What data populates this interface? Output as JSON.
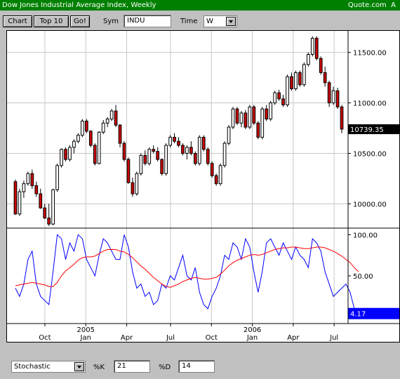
{
  "title": "Dow Jones Industrial Average Index, Weekly",
  "source": "Quote.com",
  "source_suffix": "A",
  "toolbar": {
    "chart_button": "Chart",
    "top10_button": "Top 10",
    "go_button": "Go!",
    "sym_label": "Sym",
    "sym_value": "INDU",
    "time_label": "Time",
    "time_value": "W"
  },
  "bottom": {
    "indicator_value": "Stochastic",
    "k_label": "%K",
    "k_value": "21",
    "d_label": "%D",
    "d_value": "14"
  },
  "colors": {
    "up": "#ffffff",
    "down": "#cc0000",
    "k_line": "#0000ff",
    "d_line": "#ff0000",
    "last_price_bg": "#000000",
    "last_stoch_bg": "#0000ff"
  },
  "chart_data": [
    {
      "type": "candlestick",
      "title": "",
      "ylim": [
        9760,
        11720
      ],
      "y_ticks": [
        {
          "value": 10000,
          "label": "10000.00"
        },
        {
          "value": 10500,
          "label": "10500.00"
        },
        {
          "value": 11000,
          "label": "11000.00"
        },
        {
          "value": 11500,
          "label": "11500.00"
        }
      ],
      "last_value_label": "10739.35",
      "last_value": 10739.35,
      "candles": [
        [
          10220,
          10240,
          9890,
          9900
        ],
        [
          9900,
          10150,
          9880,
          10120
        ],
        [
          10120,
          10230,
          10060,
          10200
        ],
        [
          10200,
          10320,
          10180,
          10300
        ],
        [
          10300,
          10340,
          10150,
          10180
        ],
        [
          10180,
          10220,
          10070,
          10100
        ],
        [
          10100,
          10150,
          9950,
          9960
        ],
        [
          9960,
          10000,
          9850,
          9860
        ],
        [
          9860,
          10000,
          9780,
          9800
        ],
        [
          9800,
          10150,
          9790,
          10140
        ],
        [
          10140,
          10400,
          10120,
          10380
        ],
        [
          10380,
          10550,
          10360,
          10540
        ],
        [
          10540,
          10560,
          10420,
          10440
        ],
        [
          10440,
          10580,
          10420,
          10560
        ],
        [
          10560,
          10640,
          10500,
          10620
        ],
        [
          10620,
          10700,
          10600,
          10680
        ],
        [
          10680,
          10840,
          10660,
          10820
        ],
        [
          10820,
          10840,
          10700,
          10720
        ],
        [
          10720,
          10730,
          10560,
          10580
        ],
        [
          10580,
          10600,
          10380,
          10400
        ],
        [
          10400,
          10720,
          10390,
          10710
        ],
        [
          10710,
          10830,
          10690,
          10800
        ],
        [
          10800,
          10860,
          10760,
          10840
        ],
        [
          10840,
          10940,
          10820,
          10920
        ],
        [
          10920,
          10980,
          10760,
          10780
        ],
        [
          10780,
          10790,
          10560,
          10600
        ],
        [
          10600,
          10620,
          10420,
          10440
        ],
        [
          10440,
          10460,
          10200,
          10210
        ],
        [
          10210,
          10260,
          10070,
          10100
        ],
        [
          10100,
          10320,
          10080,
          10300
        ],
        [
          10300,
          10500,
          10280,
          10480
        ],
        [
          10480,
          10530,
          10380,
          10400
        ],
        [
          10400,
          10560,
          10380,
          10540
        ],
        [
          10540,
          10580,
          10500,
          10520
        ],
        [
          10520,
          10560,
          10420,
          10440
        ],
        [
          10440,
          10450,
          10280,
          10300
        ],
        [
          10300,
          10600,
          10280,
          10580
        ],
        [
          10580,
          10680,
          10560,
          10660
        ],
        [
          10660,
          10700,
          10600,
          10620
        ],
        [
          10620,
          10660,
          10560,
          10580
        ],
        [
          10580,
          10600,
          10480,
          10500
        ],
        [
          10500,
          10580,
          10440,
          10560
        ],
        [
          10560,
          10620,
          10480,
          10500
        ],
        [
          10500,
          10520,
          10380,
          10400
        ],
        [
          10400,
          10680,
          10380,
          10660
        ],
        [
          10660,
          10680,
          10520,
          10540
        ],
        [
          10540,
          10560,
          10380,
          10400
        ],
        [
          10400,
          10420,
          10260,
          10280
        ],
        [
          10280,
          10300,
          10180,
          10200
        ],
        [
          10200,
          10400,
          10180,
          10380
        ],
        [
          10380,
          10620,
          10360,
          10600
        ],
        [
          10600,
          10780,
          10580,
          10760
        ],
        [
          10760,
          10960,
          10740,
          10940
        ],
        [
          10940,
          10960,
          10780,
          10800
        ],
        [
          10800,
          10920,
          10760,
          10900
        ],
        [
          10900,
          10930,
          10740,
          10760
        ],
        [
          10760,
          10980,
          10740,
          10960
        ],
        [
          10960,
          10980,
          10780,
          10800
        ],
        [
          10800,
          10820,
          10640,
          10660
        ],
        [
          10660,
          10960,
          10640,
          10940
        ],
        [
          10940,
          10980,
          10820,
          10840
        ],
        [
          10840,
          11020,
          10820,
          11000
        ],
        [
          11000,
          11120,
          10980,
          11100
        ],
        [
          11100,
          11130,
          11020,
          11040
        ],
        [
          11040,
          11080,
          10960,
          10980
        ],
        [
          10980,
          11280,
          10960,
          11260
        ],
        [
          11260,
          11300,
          11120,
          11140
        ],
        [
          11140,
          11320,
          11120,
          11300
        ],
        [
          11300,
          11320,
          11160,
          11180
        ],
        [
          11180,
          11400,
          11160,
          11380
        ],
        [
          11380,
          11500,
          11360,
          11480
        ],
        [
          11480,
          11660,
          11460,
          11640
        ],
        [
          11640,
          11660,
          11420,
          11440
        ],
        [
          11440,
          11460,
          11280,
          11300
        ],
        [
          11300,
          11360,
          11160,
          11200
        ],
        [
          11200,
          11220,
          10960,
          11000
        ],
        [
          11000,
          11160,
          10980,
          11120
        ],
        [
          11120,
          11150,
          10940,
          10960
        ],
        [
          10960,
          10980,
          10700,
          10740
        ]
      ]
    },
    {
      "type": "line",
      "title": "",
      "ylim": [
        -8,
        108
      ],
      "y_ticks": [
        {
          "value": 100,
          "label": "100.00"
        },
        {
          "value": 50,
          "label": "50.00"
        }
      ],
      "last_value_label": "4.17",
      "last_value": 4.17,
      "series": [
        {
          "role": "k",
          "values": [
            35,
            25,
            40,
            70,
            80,
            40,
            25,
            20,
            15,
            55,
            100,
            95,
            70,
            90,
            80,
            100,
            95,
            70,
            60,
            50,
            75,
            95,
            90,
            80,
            70,
            70,
            100,
            85,
            55,
            35,
            40,
            25,
            30,
            15,
            20,
            40,
            35,
            50,
            45,
            60,
            75,
            50,
            45,
            60,
            30,
            15,
            10,
            25,
            35,
            50,
            75,
            70,
            90,
            85,
            70,
            95,
            85,
            55,
            30,
            55,
            90,
            95,
            85,
            75,
            90,
            80,
            70,
            85,
            75,
            70,
            60,
            95,
            90,
            80,
            55,
            40,
            25,
            30,
            35,
            40,
            30,
            10,
            4.17
          ]
        },
        {
          "role": "d",
          "values": [
            38,
            39,
            40,
            41,
            42,
            41,
            40,
            39,
            37,
            37,
            42,
            50,
            56,
            60,
            64,
            69,
            72,
            73,
            73,
            74,
            77,
            80,
            82,
            82,
            82,
            80,
            79,
            76,
            72,
            67,
            62,
            58,
            53,
            48,
            44,
            40,
            37,
            36,
            38,
            40,
            43,
            45,
            47,
            48,
            47,
            46,
            46,
            47,
            48,
            52,
            57,
            62,
            66,
            69,
            71,
            73,
            75,
            76,
            75,
            76,
            78,
            80,
            82,
            83,
            84,
            84,
            85,
            85,
            84,
            83,
            83,
            84,
            85,
            85,
            84,
            82,
            80,
            77,
            74,
            70,
            66,
            60,
            55
          ]
        }
      ]
    }
  ],
  "x_labels": [
    {
      "pos": 0.18,
      "label": "Oct",
      "year": ""
    },
    {
      "pos": 0.32,
      "label": "Jan",
      "year": "2005"
    },
    {
      "pos": 0.46,
      "label": "Apr",
      "year": ""
    },
    {
      "pos": 0.61,
      "label": "Jul",
      "year": ""
    },
    {
      "pos": 0.75,
      "label": "Oct",
      "year": ""
    },
    {
      "pos": 0.89,
      "label": "Jan",
      "year": "2006"
    },
    {
      "pos": 1.03,
      "label": "Apr",
      "year": ""
    },
    {
      "pos": 1.17,
      "label": "Jul",
      "year": ""
    }
  ]
}
